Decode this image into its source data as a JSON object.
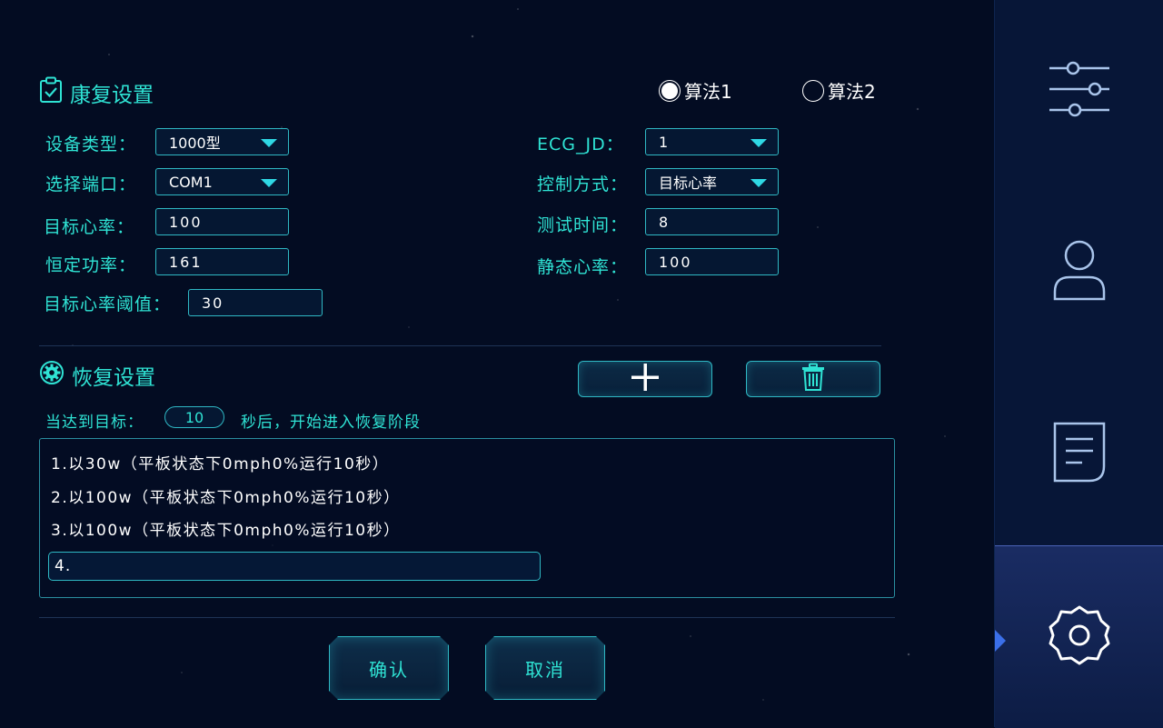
{
  "rehab": {
    "title": "康复设置",
    "algorithms": [
      {
        "label": "算法1",
        "selected": true
      },
      {
        "label": "算法2",
        "selected": false
      }
    ],
    "device_type": {
      "label": "设备类型：",
      "value": "1000型"
    },
    "port": {
      "label": "选择端口：",
      "value": "COM1"
    },
    "target_hr": {
      "label": "目标心率：",
      "value": "100"
    },
    "constant_power": {
      "label": "恒定功率：",
      "value": "161"
    },
    "target_hr_threshold": {
      "label": "目标心率阈值：",
      "value": "30"
    },
    "ecg_jd": {
      "label": "ECG_JD：",
      "value": "1"
    },
    "control_mode": {
      "label": "控制方式：",
      "value": "目标心率"
    },
    "test_time": {
      "label": "测试时间：",
      "value": "8"
    },
    "resting_hr": {
      "label": "静态心率：",
      "value": "100"
    }
  },
  "recovery": {
    "title": "恢复设置",
    "reach_label": "当达到目标：",
    "reach_seconds": "10",
    "reach_suffix": "秒后，开始进入恢复阶段",
    "steps": [
      "1.以30w（平板状态下0mph0%运行10秒）",
      "2.以100w（平板状态下0mph0%运行10秒）",
      "3.以100w（平板状态下0mph0%运行10秒）"
    ],
    "new_step_value": "4."
  },
  "actions": {
    "confirm": "确认",
    "cancel": "取消"
  },
  "sidebar": {
    "items": [
      {
        "icon": "sliders-icon",
        "active": false
      },
      {
        "icon": "user-icon",
        "active": false
      },
      {
        "icon": "document-icon",
        "active": false
      },
      {
        "icon": "gear-icon",
        "active": true
      }
    ]
  },
  "colors": {
    "accent": "#2fe3d4",
    "border": "#2fb8c4",
    "background": "#030c22",
    "sidebar": "#071637",
    "sidebar_icon": "#a9c4ea",
    "active_marker": "#3b6fe8"
  }
}
